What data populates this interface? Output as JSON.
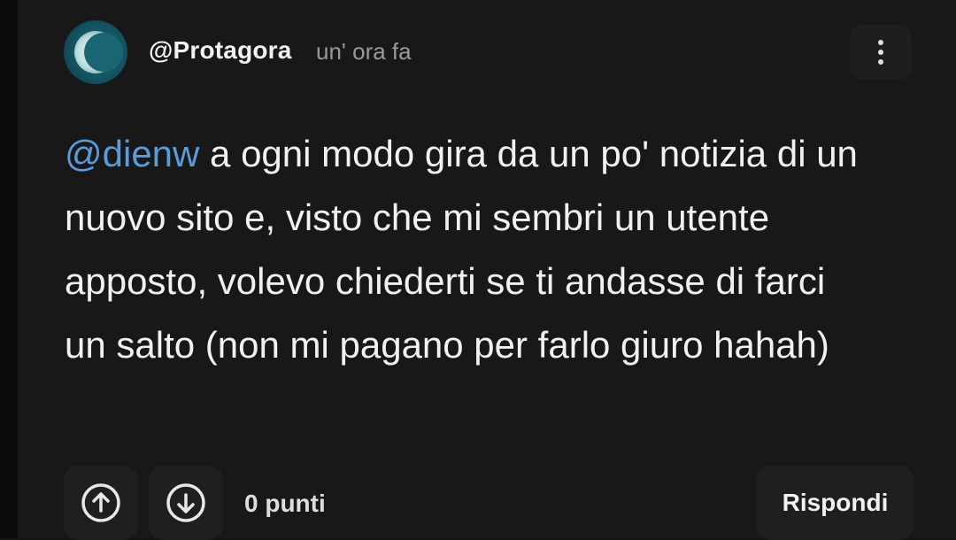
{
  "comment": {
    "author": "@Protagora",
    "time": "un' ora fa",
    "mention": "@dienw",
    "text": " a ogni modo gira da un po' notizia di un nuovo sito e, visto che mi sembri un utente apposto, volevo chiederti se ti andasse di farci un salto (non mi pagano per farlo giuro hahah)",
    "mention_color": "#5a9bdb"
  },
  "actions": {
    "points": "0 punti",
    "reply_label": "Rispondi"
  },
  "icons": {
    "menu": "more-vertical-icon",
    "upvote": "arrow-up-circle-icon",
    "downvote": "arrow-down-circle-icon",
    "avatar": "crescent-moon-avatar"
  }
}
